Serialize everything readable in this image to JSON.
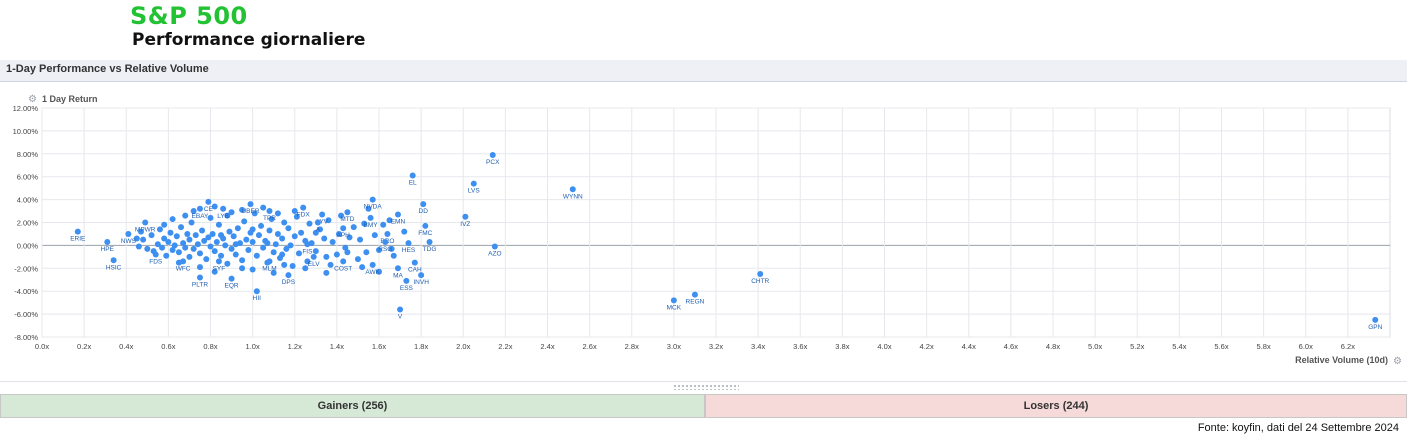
{
  "header": {
    "title": "S&P 500",
    "subtitle": "Performance giornaliere"
  },
  "panel": {
    "title": "1-Day Performance vs Relative Volume"
  },
  "icons": {
    "settings": "gear-icon"
  },
  "colors": {
    "point": "#3d8ff0",
    "gainers_bg": "#d6e9d7",
    "losers_bg": "#f6d9d9",
    "brand": "#22c233"
  },
  "chart_data": {
    "type": "scatter",
    "ylabel": "1 Day Return",
    "xlabel": "Relative Volume (10d)",
    "xlim": [
      0,
      6.4
    ],
    "ylim": [
      -8,
      12
    ],
    "grid": true,
    "x_ticks": [
      "0.0x",
      "0.2x",
      "0.4x",
      "0.6x",
      "0.8x",
      "1.0x",
      "1.2x",
      "1.4x",
      "1.6x",
      "1.8x",
      "2.0x",
      "2.2x",
      "2.4x",
      "2.6x",
      "2.8x",
      "3.0x",
      "3.2x",
      "3.4x",
      "3.6x",
      "3.8x",
      "4.0x",
      "4.2x",
      "4.4x",
      "4.6x",
      "4.8x",
      "5.0x",
      "5.2x",
      "5.4x",
      "5.6x",
      "5.8x",
      "6.0x",
      "6.2x"
    ],
    "y_ticks": [
      "12.00%",
      "10.00%",
      "8.00%",
      "6.00%",
      "4.00%",
      "2.00%",
      "0.00%",
      "-2.00%",
      "-4.00%",
      "-6.00%",
      "-8.00%"
    ],
    "labeled_points": [
      {
        "label": "PCX",
        "x": 2.14,
        "y": 7.9
      },
      {
        "label": "EL",
        "x": 1.76,
        "y": 6.1
      },
      {
        "label": "LVS",
        "x": 2.05,
        "y": 5.4
      },
      {
        "label": "WYNN",
        "x": 2.52,
        "y": 4.9
      },
      {
        "label": "NVDA",
        "x": 1.57,
        "y": 4.0
      },
      {
        "label": "IVZ",
        "x": 2.01,
        "y": 2.5
      },
      {
        "label": "EMN",
        "x": 1.69,
        "y": 2.7
      },
      {
        "label": "DD",
        "x": 1.81,
        "y": 3.6
      },
      {
        "label": "FMC",
        "x": 1.82,
        "y": 1.7
      },
      {
        "label": "TDG",
        "x": 1.84,
        "y": 0.3
      },
      {
        "label": "AZO",
        "x": 2.15,
        "y": -0.1
      },
      {
        "label": "CHTR",
        "x": 3.41,
        "y": -2.5
      },
      {
        "label": "MCK",
        "x": 3.0,
        "y": -4.8
      },
      {
        "label": "REGN",
        "x": 3.1,
        "y": -4.3
      },
      {
        "label": "GPN",
        "x": 6.33,
        "y": -6.5
      },
      {
        "label": "V",
        "x": 1.7,
        "y": -5.6
      },
      {
        "label": "ERIE",
        "x": 0.17,
        "y": 1.2
      },
      {
        "label": "HPE",
        "x": 0.31,
        "y": 0.3
      },
      {
        "label": "HSIC",
        "x": 0.34,
        "y": -1.3
      },
      {
        "label": "NWS",
        "x": 0.41,
        "y": 1.0
      },
      {
        "label": "MPWR",
        "x": 0.49,
        "y": 2.0
      },
      {
        "label": "EBAY",
        "x": 0.75,
        "y": 3.2
      },
      {
        "label": "CE",
        "x": 0.79,
        "y": 3.8
      },
      {
        "label": "LYB",
        "x": 0.86,
        "y": 3.2
      },
      {
        "label": "UBER",
        "x": 0.99,
        "y": 3.6
      },
      {
        "label": "TPR",
        "x": 1.08,
        "y": 3.0
      },
      {
        "label": "FDX",
        "x": 1.24,
        "y": 3.3
      },
      {
        "label": "LYV",
        "x": 1.33,
        "y": 2.7
      },
      {
        "label": "MTD",
        "x": 1.45,
        "y": 2.9
      },
      {
        "label": "BMY",
        "x": 1.56,
        "y": 2.4
      },
      {
        "label": "A",
        "x": 1.31,
        "y": 2.0
      },
      {
        "label": "APH",
        "x": 1.43,
        "y": 1.5
      },
      {
        "label": "BRO",
        "x": 1.64,
        "y": 1.0
      },
      {
        "label": "RSG",
        "x": 1.63,
        "y": 0.3
      },
      {
        "label": "HES",
        "x": 1.74,
        "y": 0.2
      },
      {
        "label": "FIS",
        "x": 1.26,
        "y": 0.1
      },
      {
        "label": "FDS",
        "x": 0.54,
        "y": -0.8
      },
      {
        "label": "WFC",
        "x": 0.67,
        "y": -1.4
      },
      {
        "label": "SYF",
        "x": 0.84,
        "y": -1.4
      },
      {
        "label": "MLM",
        "x": 1.08,
        "y": -1.4
      },
      {
        "label": "ELV",
        "x": 1.29,
        "y": -1.0
      },
      {
        "label": "COST",
        "x": 1.43,
        "y": -1.4
      },
      {
        "label": "AWK",
        "x": 1.57,
        "y": -1.7
      },
      {
        "label": "MA",
        "x": 1.69,
        "y": -2.0
      },
      {
        "label": "CAH",
        "x": 1.77,
        "y": -1.5
      },
      {
        "label": "ESS",
        "x": 1.73,
        "y": -3.1
      },
      {
        "label": "INVH",
        "x": 1.8,
        "y": -2.6
      },
      {
        "label": "PLTR",
        "x": 0.75,
        "y": -2.8
      },
      {
        "label": "EQR",
        "x": 0.9,
        "y": -2.9
      },
      {
        "label": "DPS",
        "x": 1.17,
        "y": -2.6
      },
      {
        "label": "HII",
        "x": 1.02,
        "y": -4.0
      }
    ],
    "unlabeled_points": [
      [
        0.48,
        0.5
      ],
      [
        0.5,
        -0.3
      ],
      [
        0.52,
        0.9
      ],
      [
        0.53,
        -0.5
      ],
      [
        0.55,
        0.1
      ],
      [
        0.56,
        1.4
      ],
      [
        0.57,
        -0.2
      ],
      [
        0.58,
        0.6
      ],
      [
        0.59,
        -0.9
      ],
      [
        0.6,
        0.3
      ],
      [
        0.61,
        1.1
      ],
      [
        0.62,
        -0.4
      ],
      [
        0.63,
        0.0
      ],
      [
        0.64,
        0.8
      ],
      [
        0.65,
        -0.6
      ],
      [
        0.66,
        1.6
      ],
      [
        0.67,
        0.2
      ],
      [
        0.68,
        -0.2
      ],
      [
        0.69,
        1.0
      ],
      [
        0.7,
        -1.0
      ],
      [
        0.7,
        0.5
      ],
      [
        0.71,
        2.0
      ],
      [
        0.72,
        -0.3
      ],
      [
        0.73,
        0.9
      ],
      [
        0.74,
        0.1
      ],
      [
        0.75,
        -0.7
      ],
      [
        0.76,
        1.3
      ],
      [
        0.77,
        0.4
      ],
      [
        0.78,
        -1.2
      ],
      [
        0.79,
        0.7
      ],
      [
        0.8,
        2.4
      ],
      [
        0.8,
        -0.1
      ],
      [
        0.81,
        1.0
      ],
      [
        0.82,
        -0.5
      ],
      [
        0.83,
        0.3
      ],
      [
        0.84,
        1.8
      ],
      [
        0.85,
        -0.9
      ],
      [
        0.86,
        0.6
      ],
      [
        0.87,
        0.0
      ],
      [
        0.88,
        2.6
      ],
      [
        0.88,
        -1.6
      ],
      [
        0.89,
        1.2
      ],
      [
        0.9,
        -0.3
      ],
      [
        0.91,
        0.8
      ],
      [
        0.92,
        -0.8
      ],
      [
        0.93,
        1.5
      ],
      [
        0.94,
        0.2
      ],
      [
        0.95,
        -1.3
      ],
      [
        0.96,
        2.1
      ],
      [
        0.97,
        0.5
      ],
      [
        0.98,
        -0.4
      ],
      [
        0.99,
        1.1
      ],
      [
        1.0,
        -2.1
      ],
      [
        1.0,
        0.3
      ],
      [
        1.01,
        2.8
      ],
      [
        1.02,
        -0.9
      ],
      [
        1.03,
        0.9
      ],
      [
        1.04,
        1.7
      ],
      [
        1.05,
        -0.2
      ],
      [
        1.06,
        0.4
      ],
      [
        1.07,
        -1.5
      ],
      [
        1.08,
        1.3
      ],
      [
        1.09,
        2.3
      ],
      [
        1.1,
        -0.6
      ],
      [
        1.11,
        0.1
      ],
      [
        1.12,
        1.0
      ],
      [
        1.13,
        -1.1
      ],
      [
        1.14,
        0.6
      ],
      [
        1.15,
        2.0
      ],
      [
        1.16,
        -0.3
      ],
      [
        1.17,
        1.5
      ],
      [
        1.18,
        0.0
      ],
      [
        1.19,
        -1.8
      ],
      [
        1.2,
        0.8
      ],
      [
        1.21,
        2.5
      ],
      [
        1.22,
        -0.7
      ],
      [
        1.23,
        1.1
      ],
      [
        1.25,
        0.4
      ],
      [
        1.26,
        -1.4
      ],
      [
        1.27,
        1.9
      ],
      [
        1.28,
        0.2
      ],
      [
        1.3,
        -0.5
      ],
      [
        1.32,
        1.4
      ],
      [
        1.34,
        0.6
      ],
      [
        1.35,
        -1.0
      ],
      [
        1.36,
        2.2
      ],
      [
        1.38,
        0.3
      ],
      [
        1.4,
        -0.8
      ],
      [
        1.41,
        1.0
      ],
      [
        1.42,
        2.6
      ],
      [
        1.44,
        -0.2
      ],
      [
        1.46,
        0.7
      ],
      [
        1.48,
        1.6
      ],
      [
        1.5,
        -1.2
      ],
      [
        1.51,
        0.5
      ],
      [
        1.53,
        1.9
      ],
      [
        1.54,
        -0.6
      ],
      [
        1.55,
        3.2
      ],
      [
        1.58,
        0.9
      ],
      [
        1.6,
        -0.4
      ],
      [
        1.62,
        1.8
      ],
      [
        1.65,
        2.2
      ],
      [
        1.67,
        -0.9
      ],
      [
        1.72,
        1.2
      ],
      [
        0.45,
        0.6
      ],
      [
        0.46,
        -0.1
      ],
      [
        0.47,
        1.2
      ],
      [
        0.72,
        3.0
      ],
      [
        0.82,
        3.4
      ],
      [
        0.9,
        2.9
      ],
      [
        0.95,
        3.1
      ],
      [
        1.05,
        3.3
      ],
      [
        1.12,
        2.8
      ],
      [
        1.2,
        3.0
      ],
      [
        1.3,
        1.1
      ],
      [
        1.37,
        -1.7
      ],
      [
        1.45,
        -0.6
      ],
      [
        1.52,
        -1.9
      ],
      [
        1.6,
        -2.3
      ],
      [
        1.66,
        -0.3
      ],
      [
        0.65,
        -1.5
      ],
      [
        0.75,
        -1.9
      ],
      [
        0.82,
        -2.3
      ],
      [
        0.95,
        -2.0
      ],
      [
        1.1,
        -2.4
      ],
      [
        1.15,
        -1.7
      ],
      [
        1.25,
        -2.0
      ],
      [
        1.35,
        -2.4
      ],
      [
        0.58,
        1.8
      ],
      [
        0.62,
        2.3
      ],
      [
        0.68,
        2.6
      ],
      [
        0.85,
        0.9
      ],
      [
        0.92,
        0.1
      ],
      [
        1.0,
        1.4
      ],
      [
        1.07,
        0.2
      ],
      [
        1.14,
        -0.8
      ]
    ]
  },
  "summary": {
    "gainers": "Gainers (256)",
    "losers": "Losers (244)"
  },
  "footer": {
    "source": "Fonte: koyfin, dati del 24 Settembre 2024"
  }
}
